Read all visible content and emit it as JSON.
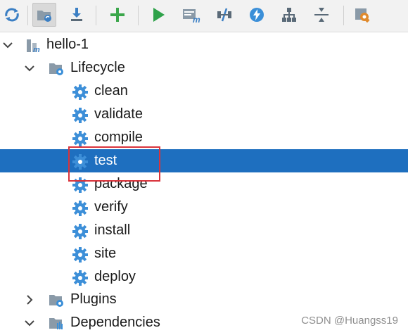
{
  "toolbar": {
    "buttons": [
      {
        "icon": "reimport-icon"
      },
      {
        "icon": "generate-sources-icon",
        "active": true
      },
      {
        "icon": "download-icon"
      },
      {
        "icon": "add-icon"
      },
      {
        "icon": "run-icon"
      },
      {
        "icon": "execute-goal-icon"
      },
      {
        "icon": "toggle-offline-icon"
      },
      {
        "icon": "skip-tests-icon"
      },
      {
        "icon": "show-dependencies-icon"
      },
      {
        "icon": "collapse-all-icon"
      },
      {
        "icon": "settings-icon"
      }
    ]
  },
  "tree": {
    "project": "hello-1",
    "lifecycle_label": "Lifecycle",
    "phases": [
      "clean",
      "validate",
      "compile",
      "test",
      "package",
      "verify",
      "install",
      "site",
      "deploy"
    ],
    "selected_phase": "test",
    "plugins_label": "Plugins",
    "dependencies_label": "Dependencies"
  },
  "colors": {
    "selection": "#1e6fbf",
    "highlight_box": "#d9333b",
    "gear": "#3d8fd8"
  },
  "watermark": "CSDN @Huangss19"
}
